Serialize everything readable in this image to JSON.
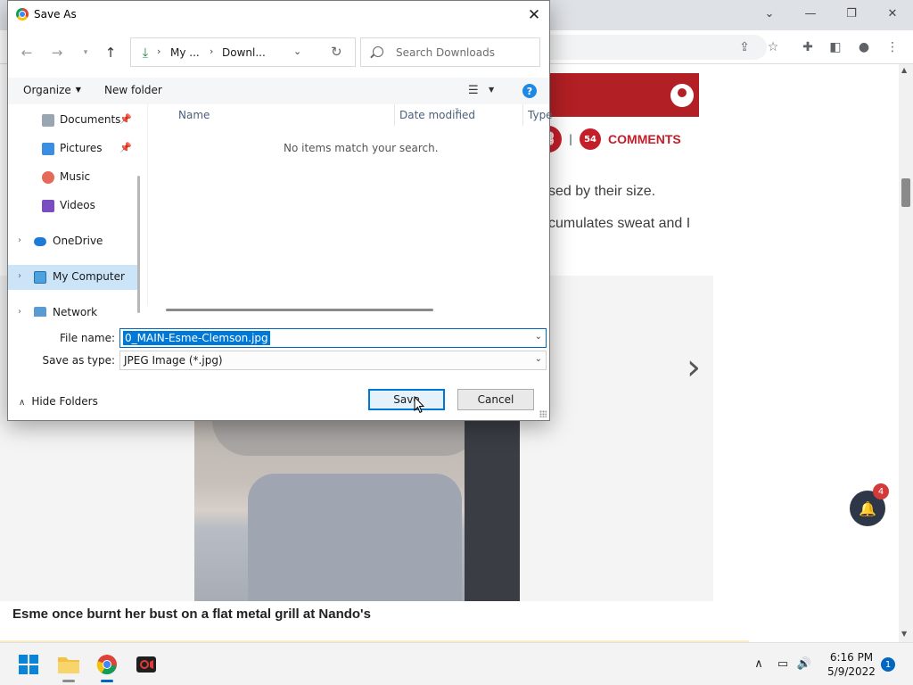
{
  "dialog": {
    "title": "Save As",
    "nav": {
      "address_segments": [
        "My ...",
        "Downl..."
      ],
      "search_placeholder": "Search Downloads"
    },
    "command_bar": {
      "organize": "Organize",
      "new_folder": "New folder"
    },
    "nav_pane": {
      "items": [
        {
          "label": "Documents",
          "icon": "documents-icon",
          "pinned": true
        },
        {
          "label": "Pictures",
          "icon": "pictures-icon",
          "pinned": true
        },
        {
          "label": "Music",
          "icon": "music-icon",
          "pinned": false
        },
        {
          "label": "Videos",
          "icon": "videos-icon",
          "pinned": false
        },
        {
          "label": "OneDrive",
          "icon": "onedrive-icon",
          "pinned": false
        },
        {
          "label": "My Computer",
          "icon": "computer-icon",
          "pinned": false,
          "selected": true
        },
        {
          "label": "Network",
          "icon": "network-icon",
          "pinned": false
        }
      ]
    },
    "file_list": {
      "columns": [
        "Name",
        "Date modified",
        "Type"
      ],
      "empty_message": "No items match your search."
    },
    "file_name_label": "File name:",
    "file_name_value": "0_MAIN-Esme-Clemson.jpg",
    "save_as_type_label": "Save as type:",
    "save_as_type_value": "JPEG Image (*.jpg)",
    "hide_folders": "Hide Folders",
    "save_button": "Save",
    "cancel_button": "Cancel"
  },
  "page": {
    "comments_count": "54",
    "comments_label": "COMMENTS",
    "article_line_1": "sed by their size.",
    "article_line_2": "cumulates sweat and I",
    "caption": "Esme once burnt her bust on a flat metal grill at Nando's",
    "notification_count": "4"
  },
  "taskbar": {
    "time": "6:16 PM",
    "date": "5/9/2022",
    "notifications": "1"
  },
  "colors": {
    "brand_red": "#b21f24",
    "accent_blue": "#0078d7",
    "selection_blue": "#cce4f7"
  }
}
